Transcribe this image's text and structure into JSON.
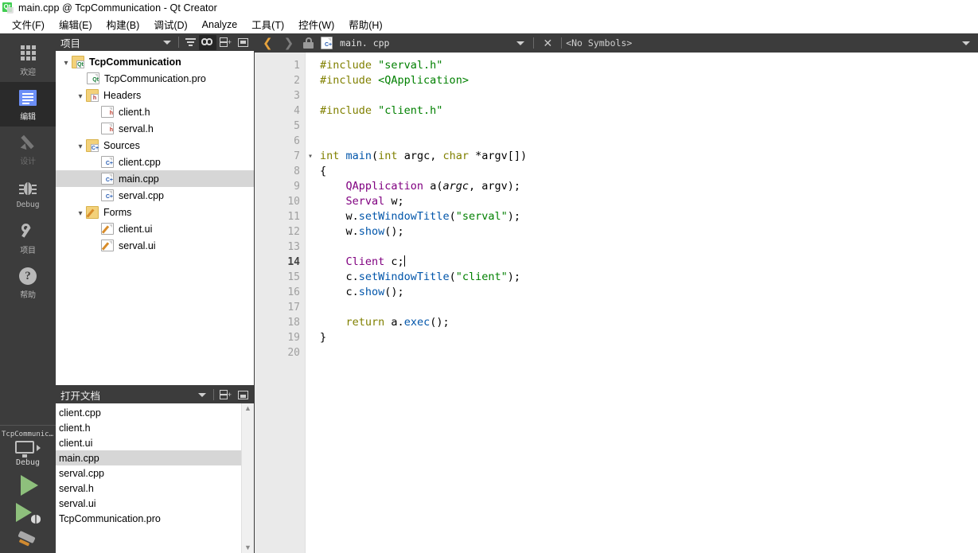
{
  "window": {
    "title": "main.cpp @ TcpCommunication - Qt Creator",
    "logo_text": "Qt"
  },
  "menubar": {
    "items": [
      {
        "label": "文件(F)",
        "name": "menu-file"
      },
      {
        "label": "编辑(E)",
        "name": "menu-edit"
      },
      {
        "label": "构建(B)",
        "name": "menu-build"
      },
      {
        "label": "调试(D)",
        "name": "menu-debug"
      },
      {
        "label": "Analyze",
        "name": "menu-analyze"
      },
      {
        "label": "工具(T)",
        "name": "menu-tools"
      },
      {
        "label": "控件(W)",
        "name": "menu-window"
      },
      {
        "label": "帮助(H)",
        "name": "menu-help"
      }
    ]
  },
  "modebar": {
    "modes": [
      {
        "label": "欢迎",
        "icon": "grid-icon",
        "state": "normal"
      },
      {
        "label": "编辑",
        "icon": "document-lines-icon",
        "state": "active"
      },
      {
        "label": "设计",
        "icon": "pencil-icon",
        "state": "disabled"
      },
      {
        "label": "Debug",
        "icon": "bug-icon",
        "state": "normal"
      },
      {
        "label": "项目",
        "icon": "wrench-icon",
        "state": "normal"
      },
      {
        "label": "帮助",
        "icon": "question-circle-icon",
        "state": "normal"
      }
    ],
    "kit": {
      "project_name": "TcpCommunication",
      "build_config": "Debug",
      "icon": "monitor-icon"
    },
    "actions": [
      {
        "name": "run-button",
        "icon": "play-icon"
      },
      {
        "name": "debug-button",
        "icon": "play-bug-icon"
      },
      {
        "name": "build-button",
        "icon": "hammer-icon"
      }
    ]
  },
  "project_pane": {
    "title": "项目",
    "toolbar": [
      {
        "name": "pane-selector-dropdown",
        "icon": "chevron-down-icon"
      },
      {
        "name": "filter-button",
        "icon": "funnel-icon"
      },
      {
        "name": "sync-with-editor-button",
        "icon": "chain-link-icon",
        "active": true
      },
      {
        "name": "split-pane-button",
        "icon": "split-add-icon"
      },
      {
        "name": "close-pane-button",
        "icon": "minimize-icon"
      }
    ],
    "tree": [
      {
        "label": "TcpCommunication",
        "depth": 0,
        "expander": "v",
        "icon": "qt-project-folder-icon",
        "bold": true,
        "selected": false
      },
      {
        "label": "TcpCommunication.pro",
        "depth": 1,
        "expander": "",
        "icon": "qt-pro-file-icon",
        "bold": false,
        "selected": false
      },
      {
        "label": "Headers",
        "depth": 1,
        "expander": "v",
        "icon": "headers-folder-icon",
        "bold": false,
        "selected": false
      },
      {
        "label": "client.h",
        "depth": 2,
        "expander": "",
        "icon": "h-file-icon",
        "bold": false,
        "selected": false
      },
      {
        "label": "serval.h",
        "depth": 2,
        "expander": "",
        "icon": "h-file-icon",
        "bold": false,
        "selected": false
      },
      {
        "label": "Sources",
        "depth": 1,
        "expander": "v",
        "icon": "sources-folder-icon",
        "bold": false,
        "selected": false
      },
      {
        "label": "client.cpp",
        "depth": 2,
        "expander": "",
        "icon": "cpp-file-icon",
        "bold": false,
        "selected": false
      },
      {
        "label": "main.cpp",
        "depth": 2,
        "expander": "",
        "icon": "cpp-file-icon",
        "bold": false,
        "selected": true
      },
      {
        "label": "serval.cpp",
        "depth": 2,
        "expander": "",
        "icon": "cpp-file-icon",
        "bold": false,
        "selected": false
      },
      {
        "label": "Forms",
        "depth": 1,
        "expander": "v",
        "icon": "forms-folder-icon",
        "bold": false,
        "selected": false
      },
      {
        "label": "client.ui",
        "depth": 2,
        "expander": "",
        "icon": "ui-file-icon",
        "bold": false,
        "selected": false
      },
      {
        "label": "serval.ui",
        "depth": 2,
        "expander": "",
        "icon": "ui-file-icon",
        "bold": false,
        "selected": false
      }
    ]
  },
  "opendocs_pane": {
    "title": "打开文档",
    "toolbar": [
      {
        "name": "opendocs-dropdown",
        "icon": "chevron-down-icon"
      },
      {
        "name": "split-pane-button",
        "icon": "split-add-icon"
      },
      {
        "name": "close-pane-button",
        "icon": "minimize-down-icon"
      }
    ],
    "documents": [
      {
        "label": "client.cpp",
        "selected": false
      },
      {
        "label": "client.h",
        "selected": false
      },
      {
        "label": "client.ui",
        "selected": false
      },
      {
        "label": "main.cpp",
        "selected": true
      },
      {
        "label": "serval.cpp",
        "selected": false
      },
      {
        "label": "serval.h",
        "selected": false
      },
      {
        "label": "serval.ui",
        "selected": false
      },
      {
        "label": "TcpCommunication.pro",
        "selected": false
      }
    ],
    "scrollbar": {
      "up": "▲",
      "down": "▼"
    }
  },
  "editor": {
    "toolbar": {
      "back_icon": "chevron-left-icon",
      "forward_icon": "chevron-right-icon",
      "lock_icon": "unlocked-icon",
      "file_icon": "cpp-file-icon",
      "filename": "main. cpp",
      "file_dropdown_icon": "chevron-down-icon",
      "close_icon": "close-icon",
      "symbols_label": "<No Symbols>",
      "overflow_icon": "chevron-down-icon"
    },
    "current_line": 14,
    "lines": [
      {
        "n": 1,
        "fold": "",
        "tokens": [
          {
            "t": "#include ",
            "c": "pp"
          },
          {
            "t": "\"serval.h\"",
            "c": "str"
          }
        ]
      },
      {
        "n": 2,
        "fold": "",
        "tokens": [
          {
            "t": "#include ",
            "c": "pp"
          },
          {
            "t": "<QApplication>",
            "c": "str"
          }
        ]
      },
      {
        "n": 3,
        "fold": "",
        "tokens": []
      },
      {
        "n": 4,
        "fold": "",
        "tokens": [
          {
            "t": "#include ",
            "c": "pp"
          },
          {
            "t": "\"client.h\"",
            "c": "str"
          }
        ]
      },
      {
        "n": 5,
        "fold": "",
        "tokens": []
      },
      {
        "n": 6,
        "fold": "",
        "tokens": []
      },
      {
        "n": 7,
        "fold": "v",
        "tokens": [
          {
            "t": "int ",
            "c": "k"
          },
          {
            "t": "main",
            "c": "fn"
          },
          {
            "t": "(",
            "c": ""
          },
          {
            "t": "int ",
            "c": "k"
          },
          {
            "t": "argc",
            "c": ""
          },
          {
            "t": ", ",
            "c": ""
          },
          {
            "t": "char ",
            "c": "k"
          },
          {
            "t": "*argv[])",
            "c": ""
          }
        ]
      },
      {
        "n": 8,
        "fold": "",
        "tokens": [
          {
            "t": "{",
            "c": ""
          }
        ]
      },
      {
        "n": 9,
        "fold": "",
        "tokens": [
          {
            "t": "    ",
            "c": ""
          },
          {
            "t": "QApplication",
            "c": "cls"
          },
          {
            "t": " a(",
            "c": ""
          },
          {
            "t": "argc",
            "c": "vi"
          },
          {
            "t": ", argv);",
            "c": ""
          }
        ]
      },
      {
        "n": 10,
        "fold": "",
        "tokens": [
          {
            "t": "    ",
            "c": ""
          },
          {
            "t": "Serval",
            "c": "cls"
          },
          {
            "t": " w;",
            "c": ""
          }
        ]
      },
      {
        "n": 11,
        "fold": "",
        "tokens": [
          {
            "t": "    w.",
            "c": ""
          },
          {
            "t": "setWindowTitle",
            "c": "fn"
          },
          {
            "t": "(",
            "c": ""
          },
          {
            "t": "\"serval\"",
            "c": "str"
          },
          {
            "t": ");",
            "c": ""
          }
        ]
      },
      {
        "n": 12,
        "fold": "",
        "tokens": [
          {
            "t": "    w.",
            "c": ""
          },
          {
            "t": "show",
            "c": "fn"
          },
          {
            "t": "();",
            "c": ""
          }
        ]
      },
      {
        "n": 13,
        "fold": "",
        "tokens": []
      },
      {
        "n": 14,
        "fold": "",
        "tokens": [
          {
            "t": "    ",
            "c": ""
          },
          {
            "t": "Client",
            "c": "cls"
          },
          {
            "t": " c;",
            "c": ""
          }
        ],
        "caret": true
      },
      {
        "n": 15,
        "fold": "",
        "tokens": [
          {
            "t": "    c.",
            "c": ""
          },
          {
            "t": "setWindowTitle",
            "c": "fn"
          },
          {
            "t": "(",
            "c": ""
          },
          {
            "t": "\"client\"",
            "c": "str"
          },
          {
            "t": ");",
            "c": ""
          }
        ]
      },
      {
        "n": 16,
        "fold": "",
        "tokens": [
          {
            "t": "    c.",
            "c": ""
          },
          {
            "t": "show",
            "c": "fn"
          },
          {
            "t": "();",
            "c": ""
          }
        ]
      },
      {
        "n": 17,
        "fold": "",
        "tokens": []
      },
      {
        "n": 18,
        "fold": "",
        "tokens": [
          {
            "t": "    ",
            "c": ""
          },
          {
            "t": "return ",
            "c": "k"
          },
          {
            "t": "a.",
            "c": ""
          },
          {
            "t": "exec",
            "c": "fn"
          },
          {
            "t": "();",
            "c": ""
          }
        ]
      },
      {
        "n": 19,
        "fold": "",
        "tokens": [
          {
            "t": "}",
            "c": ""
          }
        ]
      },
      {
        "n": 20,
        "fold": "",
        "tokens": []
      }
    ]
  },
  "colors": {
    "chrome_dark": "#3c3c3c",
    "mode_active": "#2a2a2a",
    "selection": "#d6d6d6",
    "gutter": "#eaeaea",
    "accent_green": "#8ec07c",
    "keyword": "#808000",
    "string": "#008000",
    "class": "#800080",
    "function": "#0055aa",
    "qt_green": "#41cd52"
  }
}
